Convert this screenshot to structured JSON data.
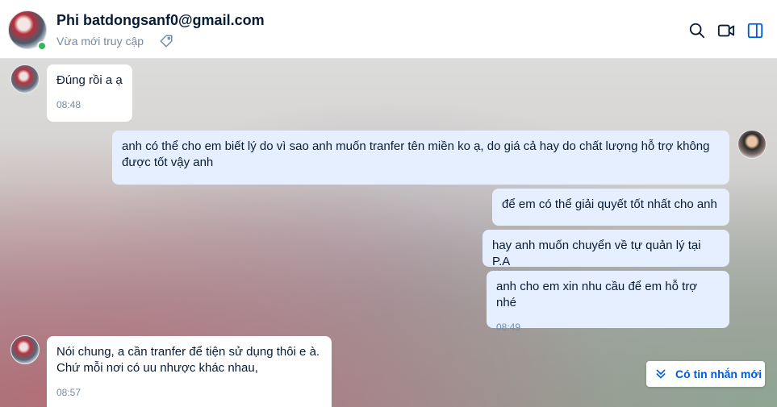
{
  "header": {
    "name": "Phi batdongsanf0@gmail.com",
    "status": "Vừa mới truy cập",
    "icons": [
      "tag-icon",
      "search-icon",
      "video-call-icon",
      "sidebar-toggle-icon"
    ]
  },
  "messages": [
    {
      "from": "contact",
      "text": "Đúng rồi a ạ",
      "time": "08:48"
    },
    {
      "from": "me",
      "text": "anh có thể cho em biết lý do vì sao anh muốn tranfer tên miền ko ạ, do giá cả hay do chất lượng hỗ trợ không được tốt vậy anh"
    },
    {
      "from": "me",
      "text": "để em có thể giải quyết tốt nhất cho anh"
    },
    {
      "from": "me",
      "text": "hay anh muốn chuyển về tự quản lý tại P.A"
    },
    {
      "from": "me",
      "text": "anh cho em xin nhu cầu để em hỗ trợ nhé",
      "time": "08:49"
    },
    {
      "from": "contact",
      "text": "Nói chung, a cần tranfer để tiện sử dụng thôi e à. Chứ mỗi nơi có uu nhược khác nhau,",
      "time": "08:57"
    }
  ],
  "new_message_button": "Có tin nhắn mới",
  "colors": {
    "accent": "#005ae0",
    "outgoing_bubble": "#e5efff",
    "incoming_bubble": "#ffffff",
    "online": "#30b85b"
  }
}
